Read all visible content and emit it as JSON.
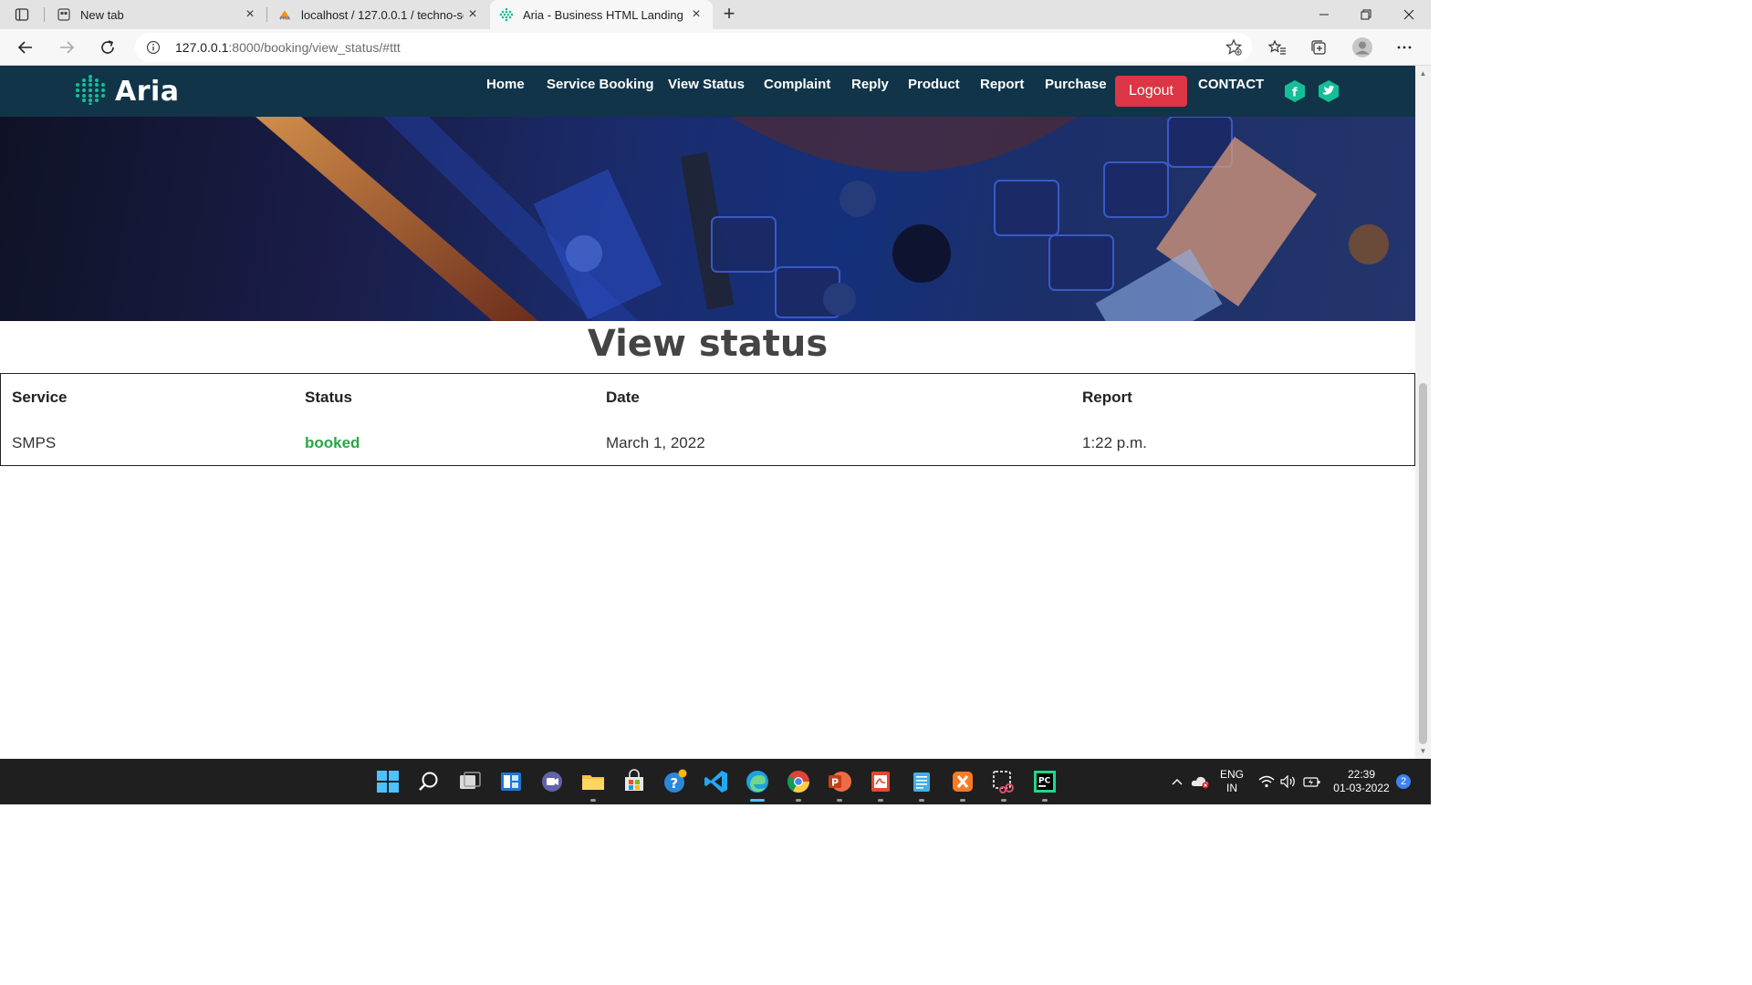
{
  "browser": {
    "tabs": [
      {
        "title": "New tab",
        "icon": "new-tab-page-icon"
      },
      {
        "title": "localhost / 127.0.0.1 / techno-ser",
        "icon": "phpmyadmin-icon"
      },
      {
        "title": "Aria - Business HTML Landing Pa",
        "icon": "aria-logo-icon"
      }
    ],
    "url_host": "127.0.0.1",
    "url_rest": ":8000/booking/view_status/#ttt"
  },
  "site": {
    "brand": "Aria",
    "nav": [
      "Home",
      "Service Booking",
      "View Status",
      "Complaint",
      "Reply",
      "Product",
      "Report",
      "Purchase"
    ],
    "logout_label": "Logout",
    "contact_label": "CONTACT",
    "social": [
      "facebook-icon",
      "twitter-icon"
    ]
  },
  "page": {
    "title": "View status",
    "table": {
      "headers": [
        "Service",
        "Status",
        "Date",
        "Report"
      ],
      "rows": [
        {
          "service": "SMPS",
          "status": "booked",
          "date": "March 1, 2022",
          "report": "1:22 p.m."
        }
      ]
    }
  },
  "colors": {
    "navbar": "#113448",
    "accent": "#14bf98",
    "logout": "#dc3545",
    "status_booked": "#28a745"
  },
  "taskbar": {
    "language": "ENG",
    "region": "IN",
    "time": "22:39",
    "date": "01-03-2022",
    "notifications": "2"
  }
}
